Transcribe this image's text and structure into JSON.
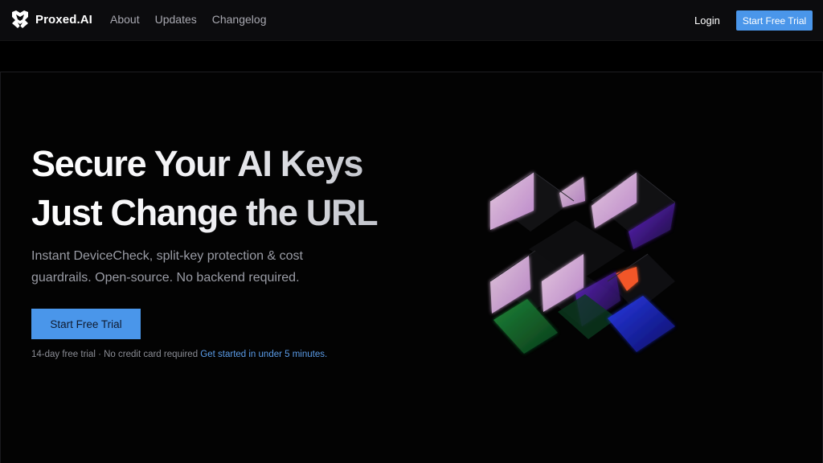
{
  "nav": {
    "brand": "Proxed.AI",
    "links": [
      "About",
      "Updates",
      "Changelog"
    ],
    "login": "Login",
    "cta": "Start Free Trial"
  },
  "hero": {
    "headline_line1": "Secure Your AI Keys",
    "headline_line2": "Just Change the URL",
    "subheadline": "Instant DeviceCheck, split-key protection & cost guardrails. Open-source. No backend required.",
    "cta": "Start Free Trial",
    "note_text": "14-day free trial · No credit card required",
    "note_link": "Get started in under 5 minutes."
  },
  "colors": {
    "accent": "#4a96ea",
    "background": "#000000",
    "nav_background": "#0c0c0e",
    "muted_text": "#9a9ca5"
  },
  "icons": {
    "brand": "shield-logo-icon",
    "hero_art": "glowing-cubes-illustration"
  }
}
